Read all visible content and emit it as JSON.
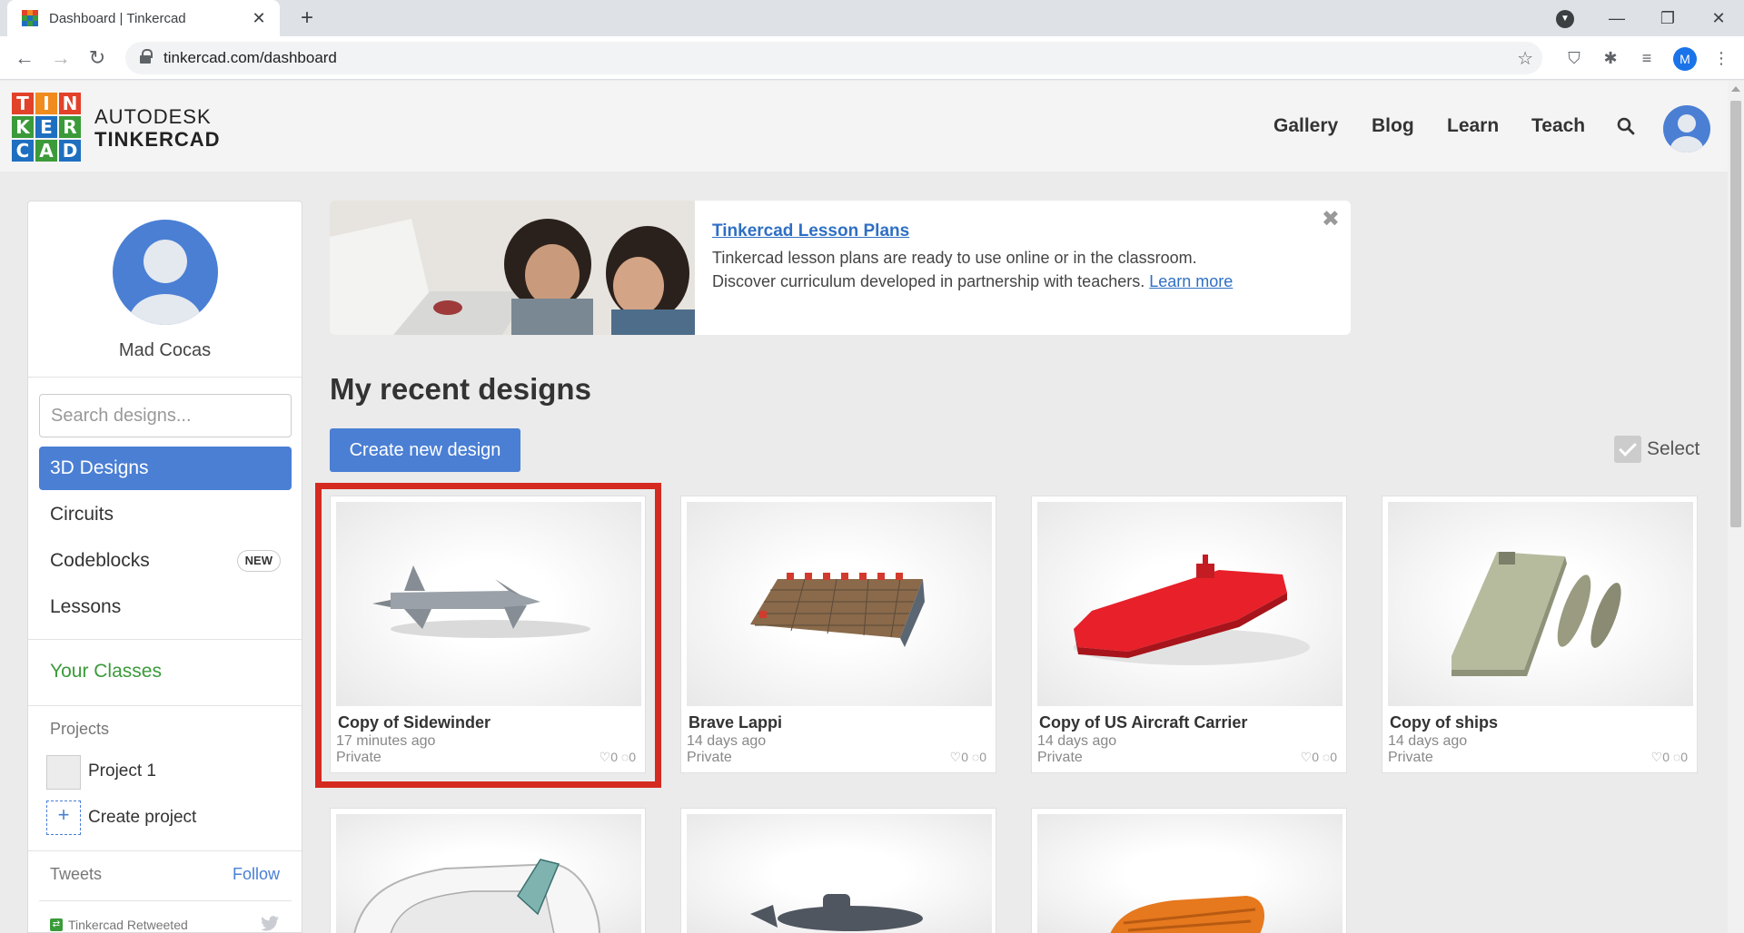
{
  "browser": {
    "tab_title": "Dashboard | Tinkercad",
    "tab_close": "✕",
    "new_tab": "+",
    "url": "tinkercad.com/dashboard",
    "profile_initial": "M"
  },
  "header": {
    "logo_letters": [
      "T",
      "I",
      "N",
      "K",
      "E",
      "R",
      "C",
      "A",
      "D"
    ],
    "logo_colors": [
      "#e2412a",
      "#f08b1d",
      "#e2412a",
      "#3b9a3a",
      "#1e6fc0",
      "#3b9a3a",
      "#1e6fc0",
      "#3b9a3a",
      "#1e6fc0"
    ],
    "brand_top": "AUTODESK",
    "brand_bottom": "TINKERCAD",
    "nav": {
      "gallery": "Gallery",
      "blog": "Blog",
      "learn": "Learn",
      "teach": "Teach"
    }
  },
  "sidebar": {
    "user_name": "Mad Cocas",
    "search_placeholder": "Search designs...",
    "items": [
      {
        "label": "3D Designs"
      },
      {
        "label": "Circuits"
      },
      {
        "label": "Codeblocks",
        "badge": "NEW"
      },
      {
        "label": "Lessons"
      }
    ],
    "classes": "Your Classes",
    "projects_label": "Projects",
    "projects": [
      {
        "label": "Project 1"
      }
    ],
    "create_project": "Create project",
    "create_project_icon": "+",
    "tweets_label": "Tweets",
    "follow": "Follow",
    "retweeted": "Tinkercad Retweeted"
  },
  "banner": {
    "title": "Tinkercad Lesson Plans",
    "text": "Tinkercad lesson plans are ready to use online or in the classroom. Discover curriculum developed in partnership with teachers. ",
    "learn_more": "Learn more",
    "close": "✖"
  },
  "designs": {
    "heading": "My recent designs",
    "create_button": "Create new design",
    "select_label": "Select",
    "cards": [
      {
        "title": "Copy of Sidewinder",
        "time": "17 minutes ago",
        "privacy": "Private",
        "stats": "♡0 ◌0"
      },
      {
        "title": "Brave Lappi",
        "time": "14 days ago",
        "privacy": "Private",
        "stats": "♡0 ◌0"
      },
      {
        "title": "Copy of US Aircraft Carrier",
        "time": "14 days ago",
        "privacy": "Private",
        "stats": "♡0 ◌0"
      },
      {
        "title": "Copy of ships",
        "time": "14 days ago",
        "privacy": "Private",
        "stats": "♡0 ◌0"
      }
    ]
  },
  "colors": {
    "accent": "#4a7fd4",
    "highlight": "#d42a1f",
    "classes": "#3a9b3a"
  }
}
